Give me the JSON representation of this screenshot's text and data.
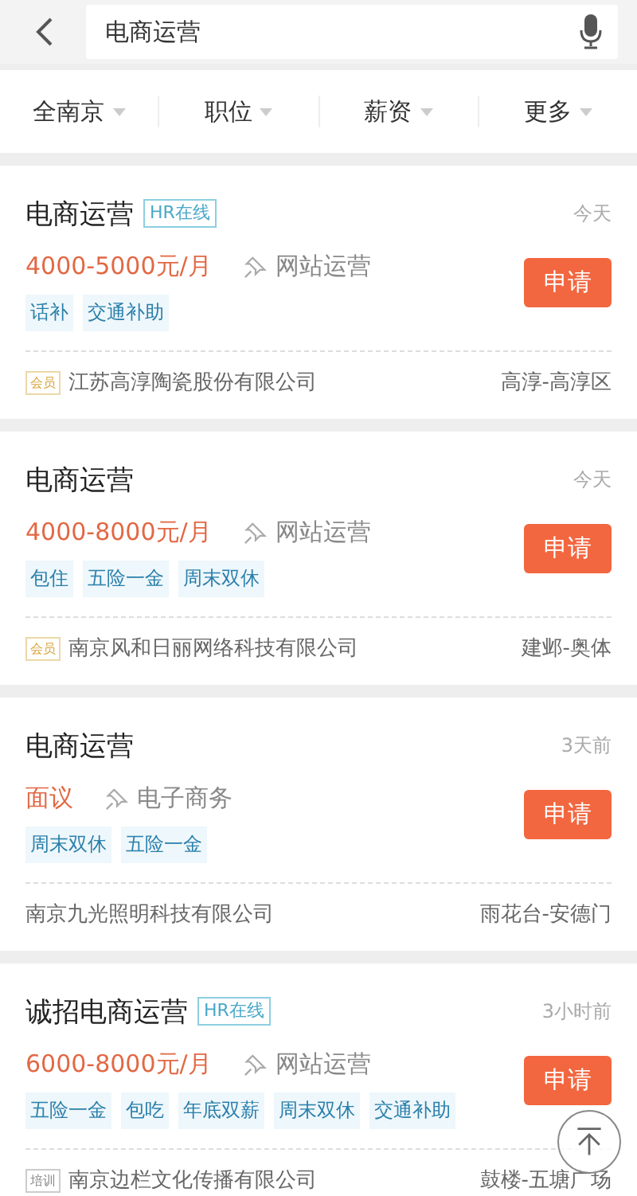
{
  "search": {
    "value": "电商运营"
  },
  "filters": [
    {
      "label": "全南京"
    },
    {
      "label": "职位"
    },
    {
      "label": "薪资"
    },
    {
      "label": "更多"
    }
  ],
  "jobs": [
    {
      "title": "电商运营",
      "hr_online": "HR在线",
      "time": "今天",
      "salary": "4000-5000元/月",
      "category": "网站运营",
      "tags": [
        "话补",
        "交通补助"
      ],
      "apply": "申请",
      "badge": {
        "text": "会员",
        "kind": "member"
      },
      "company": "江苏高淳陶瓷股份有限公司",
      "location": "高淳-高淳区"
    },
    {
      "title": "电商运营",
      "time": "今天",
      "salary": "4000-8000元/月",
      "category": "网站运营",
      "tags": [
        "包住",
        "五险一金",
        "周末双休"
      ],
      "apply": "申请",
      "badge": {
        "text": "会员",
        "kind": "member"
      },
      "company": "南京风和日丽网络科技有限公司",
      "location": "建邺-奥体"
    },
    {
      "title": "电商运营",
      "time": "3天前",
      "salary": "面议",
      "category": "电子商务",
      "tags": [
        "周末双休",
        "五险一金"
      ],
      "apply": "申请",
      "company": "南京九光照明科技有限公司",
      "location": "雨花台-安德门"
    },
    {
      "title": "诚招电商运营",
      "hr_online": "HR在线",
      "time": "3小时前",
      "salary": "6000-8000元/月",
      "category": "网站运营",
      "tags": [
        "五险一金",
        "包吃",
        "年底双薪",
        "周末双休",
        "交通补助"
      ],
      "apply": "申请",
      "badge": {
        "text": "培训",
        "kind": "training"
      },
      "company": "南京边栏文化传播有限公司",
      "location": "鼓楼-五塘广场"
    }
  ]
}
